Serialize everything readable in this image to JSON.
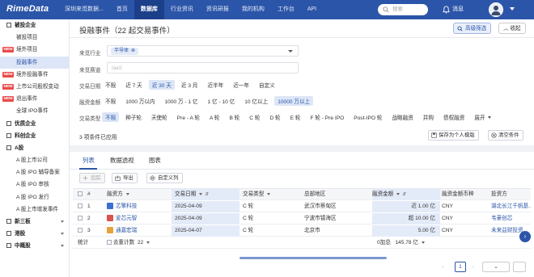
{
  "brand": "RimeData",
  "nav": [
    "深圳来觅数据...",
    "首页",
    "数据库",
    "行业资讯",
    "资讯研报",
    "我的机构",
    "工作台",
    "API"
  ],
  "nav_active_index": 2,
  "search_placeholder": "搜索",
  "messages_label": "消息",
  "sidebar": [
    {
      "label": "被投企业",
      "type": "group"
    },
    {
      "label": "被投项目",
      "type": "item"
    },
    {
      "label": "境外项目",
      "type": "item",
      "badge": "NEW"
    },
    {
      "label": "投融事件",
      "type": "item",
      "active": true
    },
    {
      "label": "境外投融事件",
      "type": "item",
      "badge": "NEW"
    },
    {
      "label": "上市公司股权变动",
      "type": "item",
      "badge": "NEW"
    },
    {
      "label": "退出事件",
      "type": "item",
      "badge": "NEW"
    },
    {
      "label": "全球 IPO事件",
      "type": "item"
    },
    {
      "label": "优质企业",
      "type": "group"
    },
    {
      "label": "科创企业",
      "type": "group"
    },
    {
      "label": "A股",
      "type": "group",
      "expanded": true
    },
    {
      "label": "A 股上市公司",
      "type": "item"
    },
    {
      "label": "A 股 IPO 辅导备案",
      "type": "item"
    },
    {
      "label": "A 股 IPO 审核",
      "type": "item"
    },
    {
      "label": "A 股 IPO 发行",
      "type": "item"
    },
    {
      "label": "A 股上市增发事件",
      "type": "item"
    },
    {
      "label": "新三板",
      "type": "group",
      "chev": true
    },
    {
      "label": "港股",
      "type": "group",
      "chev": true
    },
    {
      "label": "中概股",
      "type": "group",
      "chev": true
    }
  ],
  "page_title": "投融事件（22 起交易事件）",
  "advanced_filter_label": "高级筛选",
  "collapse_label": "收起",
  "filters": {
    "industry": {
      "label": "来觅行业",
      "chip": "半导体"
    },
    "track": {
      "label": "来觅赛道",
      "placeholder": "IaaS"
    },
    "date": {
      "label": "交易日期",
      "options": [
        "不限",
        "近 7 天",
        "近 30 天",
        "近 3 月",
        "近半年",
        "近一年",
        "自定义"
      ],
      "selected": 2
    },
    "amount": {
      "label": "融资金额",
      "options": [
        "不限",
        "1000 万以内",
        "1000 万 - 1 亿",
        "1 亿 - 10 亿",
        "10 亿以上",
        "10000 万以上"
      ],
      "selected": 5
    },
    "type": {
      "label": "交易类型",
      "options": [
        "不限",
        "种子轮",
        "天使轮",
        "Pre - A 轮",
        "A 轮",
        "B 轮",
        "C 轮",
        "D 轮",
        "E 轮",
        "F 轮 - Pre IPO",
        "Post-IPO 轮",
        "战略融资",
        "并购",
        "债权融资",
        "展开"
      ],
      "selected": 0
    }
  },
  "applied_text": "3 项条件已应用",
  "save_template_label": "保存为个人模版",
  "clear_label": "清空条件",
  "tabs": [
    "列表",
    "数据透视",
    "图表"
  ],
  "active_tab": 0,
  "toolbar": {
    "track": "追踪",
    "export": "导出",
    "custom_columns": "自定义列"
  },
  "columns": [
    "#",
    "融资方",
    "交易日期",
    "交易类型",
    "总部地区",
    "融资金额",
    "融资金额币种",
    "投资方"
  ],
  "rows": [
    {
      "idx": "1",
      "company": "芯擎科技",
      "date": "2025-04-09",
      "round": "C 轮",
      "region": "武汉市蔡甸区",
      "amount": "近 1.00 亿",
      "currency": "CNY",
      "investor": "湖北长江千帆基...",
      "logo_color": "#3b6fd1"
    },
    {
      "idx": "2",
      "company": "爱芯元智",
      "date": "2025-04-09",
      "round": "C 轮",
      "region": "宁波市镇海区",
      "amount": "超 10.00 亿",
      "currency": "CNY",
      "investor": "韦豪创芯",
      "logo_color": "#d9534f"
    },
    {
      "idx": "3",
      "company": "通嘉宏瑞",
      "date": "2025-04-07",
      "round": "C 轮",
      "region": "北京市",
      "amount": "5.00 亿",
      "currency": "CNY",
      "investor": "未来益财投资",
      "logo_color": "#e6a23c"
    }
  ],
  "footer": {
    "stats_label": "统计",
    "dedup_label": "去重计数",
    "dedup_count": "22",
    "sum_label": "0加总",
    "sum_value": "145.78 亿"
  },
  "pager": {
    "current": "1"
  }
}
